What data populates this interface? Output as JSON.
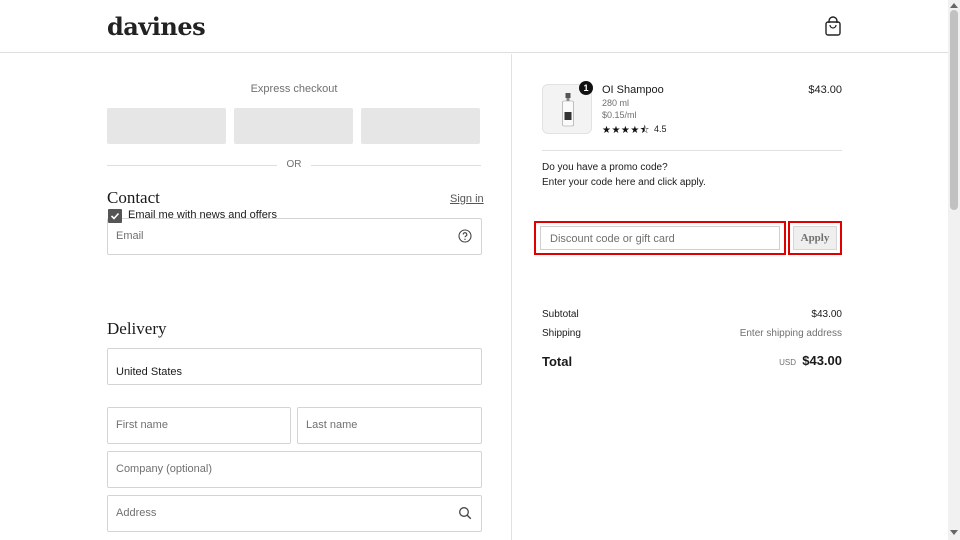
{
  "brand": {
    "logo_text": "davines"
  },
  "header": {
    "cart_icon": "shopping-bag-icon"
  },
  "express": {
    "label": "Express checkout",
    "divider_text": "OR"
  },
  "contact": {
    "title": "Contact",
    "signin_label": "Sign in",
    "email_placeholder": "Email",
    "email_help_icon": "question-circle-icon",
    "newsletter_label": "Email me with news and offers",
    "newsletter_checked": true
  },
  "delivery": {
    "title": "Delivery",
    "country_value": "United States",
    "first_name_placeholder": "First name",
    "last_name_placeholder": "Last name",
    "company_placeholder": "Company (optional)",
    "address_placeholder": "Address",
    "address_icon": "search-icon"
  },
  "cart": {
    "item": {
      "quantity": "1",
      "name": "OI Shampoo",
      "size": "280 ml",
      "unit_price": "$0.15/ml",
      "stars": "★★★★⯪",
      "rating": "4.5",
      "price": "$43.00"
    },
    "promo_question": "Do you have a promo code?",
    "promo_instructions": "Enter your code here and click apply.",
    "discount_placeholder": "Discount code or gift card",
    "apply_label": "Apply"
  },
  "summary": {
    "subtotal_label": "Subtotal",
    "subtotal_value": "$43.00",
    "shipping_label": "Shipping",
    "shipping_value": "Enter shipping address",
    "total_label": "Total",
    "total_currency": "USD",
    "total_value": "$43.00"
  },
  "colors": {
    "highlight": "#e00000",
    "express_button": "#e6e6e6",
    "text": "#1a1a1a"
  }
}
